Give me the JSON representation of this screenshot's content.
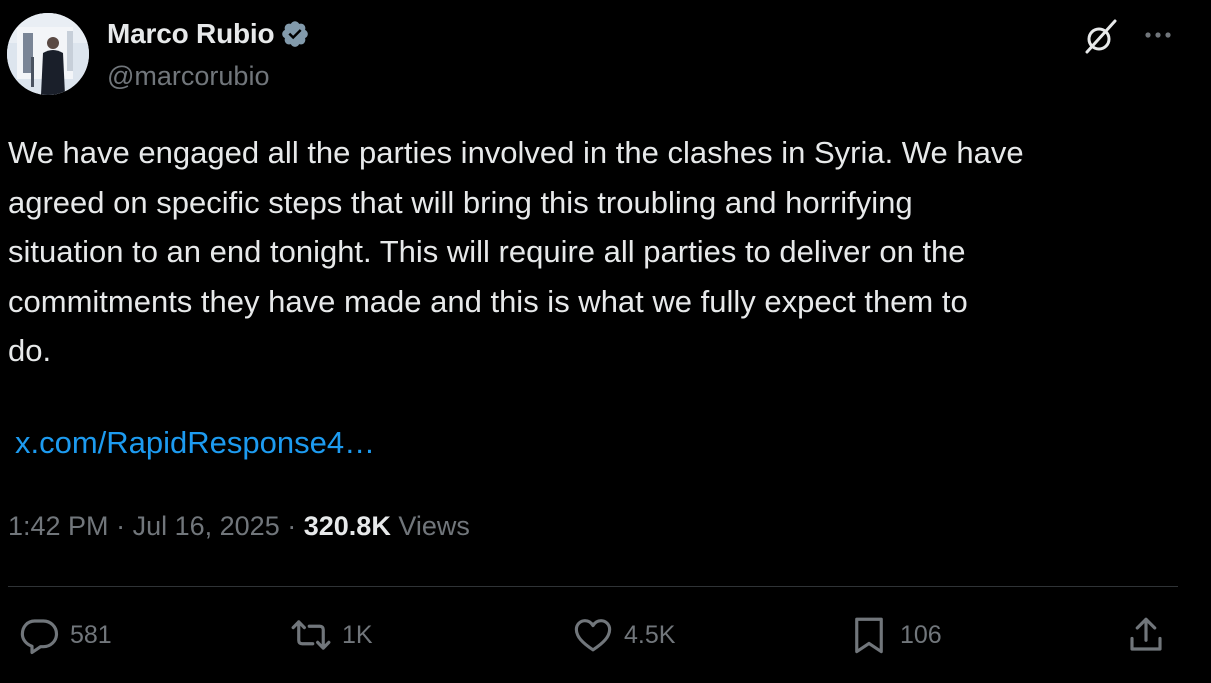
{
  "author": {
    "name": "Marco Rubio",
    "handle": "@marcorubio",
    "verified_badge_color": "#829aab"
  },
  "post": {
    "text": "We have engaged all the parties involved in the clashes in Syria. We have\nagreed on specific steps that will bring this troubling and horrifying\nsituation to an end tonight. This will require all parties to deliver on the\ncommitments they have made and this is what we fully expect them to\ndo.",
    "link": "x.com/RapidResponse4…",
    "time": "1:42 PM",
    "date": "Jul 16, 2025",
    "views_count": "320.8K",
    "views_label": "Views",
    "separator": "·"
  },
  "actions": {
    "replies": "581",
    "reposts": "1K",
    "likes": "4.5K",
    "bookmarks": "106"
  },
  "icons": [
    "verified-badge-icon",
    "grok-icon",
    "more-icon",
    "reply-icon",
    "repost-icon",
    "like-icon",
    "bookmark-icon",
    "share-icon"
  ],
  "colors": {
    "background": "#000000",
    "text": "#e7e9ea",
    "secondary": "#71767b",
    "link": "#1d9bf0",
    "divider": "#2f3336"
  }
}
